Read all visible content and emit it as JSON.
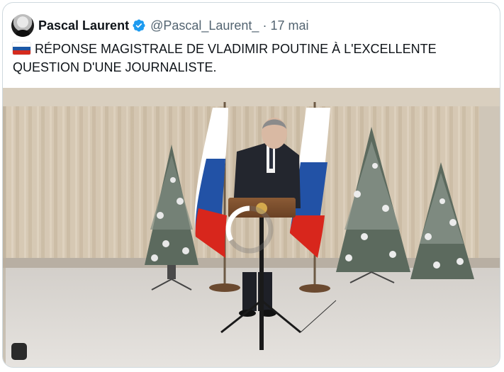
{
  "author": {
    "display_name": "Pascal Laurent",
    "handle": "@Pascal_Laurent_",
    "separator": "·",
    "timestamp": "17 mai",
    "avatar_icon": "profile-avatar",
    "verified_icon": "verified-badge-icon",
    "verified_color": "#1d9bf0"
  },
  "tweet": {
    "flag_icon": "russia-flag-emoji",
    "text": "RÉPONSE MAGISTRALE DE VLADIMIR POUTINE À L'EXCELLENTE QUESTION D'UNE JOURNALISTE."
  },
  "media": {
    "type": "video",
    "loading_icon": "loading-spinner-icon",
    "playback_icon": "video-control-badge"
  },
  "colors": {
    "text_primary": "#0f1419",
    "text_secondary": "#536471",
    "border": "#cfd9de"
  }
}
